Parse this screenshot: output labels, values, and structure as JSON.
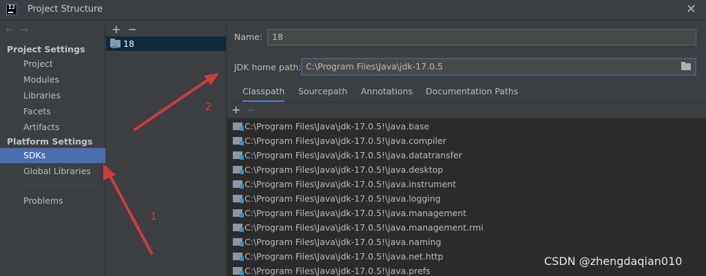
{
  "window": {
    "title": "Project Structure",
    "app_icon": "IJ"
  },
  "sidebar": {
    "nav_back": "←",
    "nav_forward": "→",
    "project_settings_header": "Project Settings",
    "project_items": [
      "Project",
      "Modules",
      "Libraries",
      "Facets",
      "Artifacts"
    ],
    "platform_settings_header": "Platform Settings",
    "platform_items": [
      "SDKs",
      "Global Libraries"
    ],
    "problems": "Problems",
    "selected": "SDKs"
  },
  "sdk_panel": {
    "add": "+",
    "remove": "−",
    "sdks": [
      "18"
    ]
  },
  "detail": {
    "name_label": "Name:",
    "name_value": "18",
    "jdk_home_label": "JDK home path:",
    "jdk_home_value": "C:\\Program Files\\Java\\jdk-17.0.5",
    "tabs": [
      "Classpath",
      "Sourcepath",
      "Annotations",
      "Documentation Paths"
    ],
    "active_tab": "Classpath",
    "list_add": "+",
    "list_remove": "−",
    "classpath": [
      "C:\\Program Files\\Java\\jdk-17.0.5!\\java.base",
      "C:\\Program Files\\Java\\jdk-17.0.5!\\java.compiler",
      "C:\\Program Files\\Java\\jdk-17.0.5!\\java.datatransfer",
      "C:\\Program Files\\Java\\jdk-17.0.5!\\java.desktop",
      "C:\\Program Files\\Java\\jdk-17.0.5!\\java.instrument",
      "C:\\Program Files\\Java\\jdk-17.0.5!\\java.logging",
      "C:\\Program Files\\Java\\jdk-17.0.5!\\java.management",
      "C:\\Program Files\\Java\\jdk-17.0.5!\\java.management.rmi",
      "C:\\Program Files\\Java\\jdk-17.0.5!\\java.naming",
      "C:\\Program Files\\Java\\jdk-17.0.5!\\java.net.http",
      "C:\\Program Files\\Java\\jdk-17.0.5!\\java.prefs"
    ]
  },
  "annotations": {
    "marker_1": "1",
    "marker_2": "2",
    "color": "#d23a3a"
  },
  "watermark": "CSDN @zhengdaqian010",
  "colors": {
    "selection": "#4b6eaf",
    "tab_underline": "#4a88c7",
    "list_bg": "#2b2b2b",
    "panel_bg": "#3c3f41"
  }
}
